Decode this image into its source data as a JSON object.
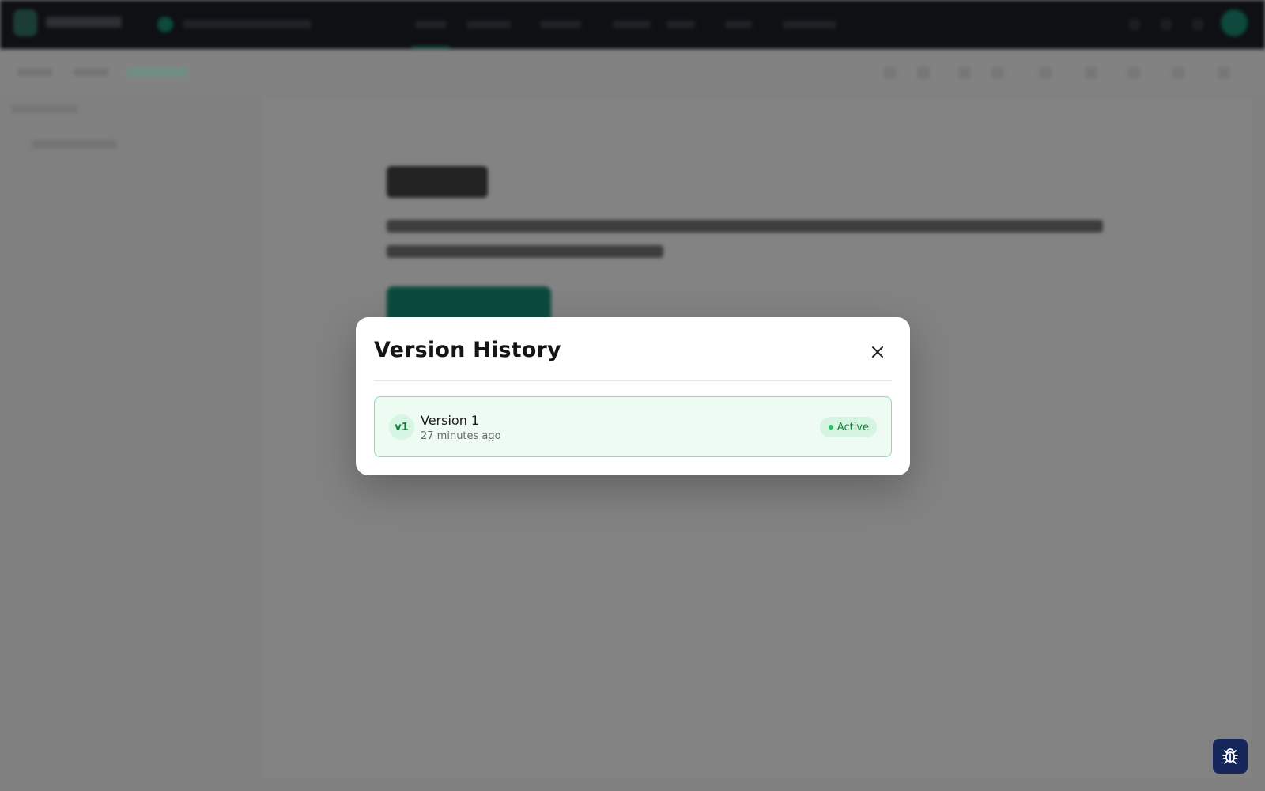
{
  "modal": {
    "title": "Version History",
    "close_icon": "close-icon",
    "versions": [
      {
        "badge": "v1",
        "name": "Version 1",
        "time": "27 minutes ago",
        "status": "Active"
      }
    ]
  },
  "fab": {
    "icon": "bug-icon"
  },
  "colors": {
    "accent_green": "#22c55e",
    "card_border": "#86e0ab",
    "card_bg": "#eefbf3",
    "fab_bg": "#15265a",
    "overlay": "#808080"
  }
}
